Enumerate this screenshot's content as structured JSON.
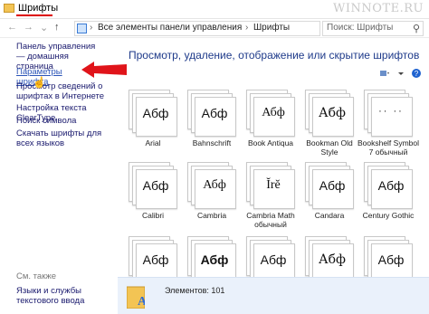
{
  "window": {
    "title": "Шрифты",
    "watermark": "WINNOTE.RU"
  },
  "nav": {
    "back": "←",
    "forward": "→",
    "recent": "⌄",
    "up": "↑"
  },
  "address": {
    "crumbs": [
      "Все элементы панели управления",
      "Шрифты"
    ],
    "sep": "›"
  },
  "search": {
    "placeholder": "Поиск: Шрифты"
  },
  "sidebar": {
    "items": [
      {
        "label": "Панель управления — домашняя страница"
      },
      {
        "label": "Параметры шрифта"
      },
      {
        "label": "Просмотр сведений о шрифтах в Интернете"
      },
      {
        "label": "Настройка текста ClearType"
      },
      {
        "label": "Поиск символа"
      },
      {
        "label": "Скачать шрифты для всех языков"
      }
    ],
    "see_also": "См. также",
    "see_also_items": [
      {
        "label": "Языки и службы текстового ввода"
      }
    ]
  },
  "main": {
    "heading": "Просмотр, удаление, отображение или скрытие шрифтов",
    "fonts": [
      {
        "name": "Arial",
        "sample": "Абф"
      },
      {
        "name": "Bahnschrift",
        "sample": "Абф"
      },
      {
        "name": "Book Antiqua",
        "sample": "Абф"
      },
      {
        "name": "Bookman Old Style",
        "sample": "Абф"
      },
      {
        "name": "Bookshelf Symbol 7 обычный",
        "sample": "·· ··"
      },
      {
        "name": "Calibri",
        "sample": "Абф"
      },
      {
        "name": "Cambria",
        "sample": "Абф"
      },
      {
        "name": "Cambria Math обычный",
        "sample": "Ĭrĕ"
      },
      {
        "name": "Candara",
        "sample": "Абф"
      },
      {
        "name": "Century Gothic",
        "sample": "Абф"
      },
      {
        "name": "",
        "sample": "Абф"
      },
      {
        "name": "",
        "sample": "Абф"
      },
      {
        "name": "",
        "sample": "Абф"
      },
      {
        "name": "",
        "sample": "Абф"
      },
      {
        "name": "",
        "sample": "Абф"
      }
    ]
  },
  "status": {
    "count": "Элементов: 101"
  },
  "colors": {
    "accent": "#2c55b8",
    "arrow": "#e0141a",
    "status_bg": "#eaf1fb"
  }
}
